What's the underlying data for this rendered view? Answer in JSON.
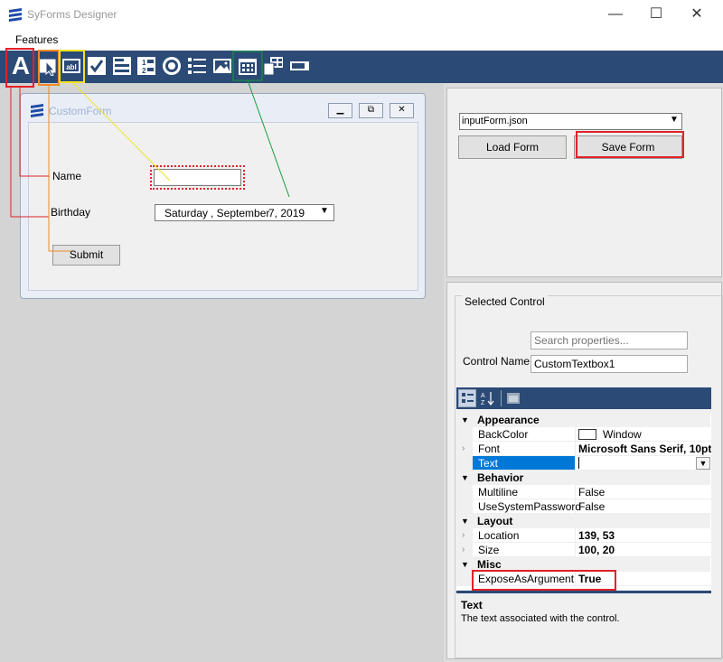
{
  "window": {
    "title": "SyForms Designer",
    "minimize": "—",
    "maximize": "☐",
    "close": "✕"
  },
  "menu": {
    "features": "Features"
  },
  "toolbar": {
    "tools": [
      {
        "name": "label-tool",
        "glyph": "A"
      },
      {
        "name": "button-tool",
        "glyph": ""
      },
      {
        "name": "textbox-tool",
        "glyph": "abl"
      },
      {
        "name": "checkbox-tool",
        "glyph": "✓"
      },
      {
        "name": "combobox-tool",
        "glyph": ""
      },
      {
        "name": "numeric-tool",
        "glyph": ""
      },
      {
        "name": "radio-tool",
        "glyph": ""
      },
      {
        "name": "list-tool",
        "glyph": ""
      },
      {
        "name": "image-tool",
        "glyph": ""
      },
      {
        "name": "datetime-tool",
        "glyph": ""
      },
      {
        "name": "grid-tool",
        "glyph": ""
      },
      {
        "name": "progress-tool",
        "glyph": ""
      }
    ]
  },
  "form": {
    "title": "CustomForm",
    "name_label": "Name",
    "birthday_label": "Birthday",
    "date_day": "Saturday",
    "date_month": ", September",
    "date_rest": "7, 2019",
    "submit": "Submit"
  },
  "file_panel": {
    "selected_file": "inputForm.json",
    "load_button": "Load Form",
    "save_button": "Save Form"
  },
  "selected_control": {
    "group_title": "Selected Control",
    "search_placeholder": "Search properties...",
    "control_name_label": "Control Name",
    "control_name_value": "CustomTextbox1"
  },
  "property_grid": {
    "rows": [
      {
        "kind": "cat",
        "label": "Appearance"
      },
      {
        "kind": "prop",
        "label": "BackColor",
        "value": "Window",
        "swatch": true
      },
      {
        "kind": "prop",
        "label": "Font",
        "value": "Microsoft Sans Serif, 10pt",
        "bold": true,
        "expandable": true
      },
      {
        "kind": "prop",
        "label": "Text",
        "value": "",
        "selected": true
      },
      {
        "kind": "cat",
        "label": "Behavior"
      },
      {
        "kind": "prop",
        "label": "Multiline",
        "value": "False"
      },
      {
        "kind": "prop",
        "label": "UseSystemPassword",
        "value": "False"
      },
      {
        "kind": "cat",
        "label": "Layout"
      },
      {
        "kind": "prop",
        "label": "Location",
        "value": "139, 53",
        "bold": true,
        "expandable": true
      },
      {
        "kind": "prop",
        "label": "Size",
        "value": "100, 20",
        "bold": true,
        "expandable": true
      },
      {
        "kind": "cat",
        "label": "Misc"
      },
      {
        "kind": "prop",
        "label": "ExposeAsArgument",
        "value": "True",
        "bold": true
      }
    ],
    "help_title": "Text",
    "help_text": "The text associated with the control."
  },
  "colors": {
    "toolbar": "#2b4a76",
    "annotation_red": "#e0222a",
    "annotation_orange": "#f08a24",
    "annotation_yellow": "#f3e21c",
    "annotation_green": "#1a9c3a",
    "selection_blue": "#0078d7"
  }
}
